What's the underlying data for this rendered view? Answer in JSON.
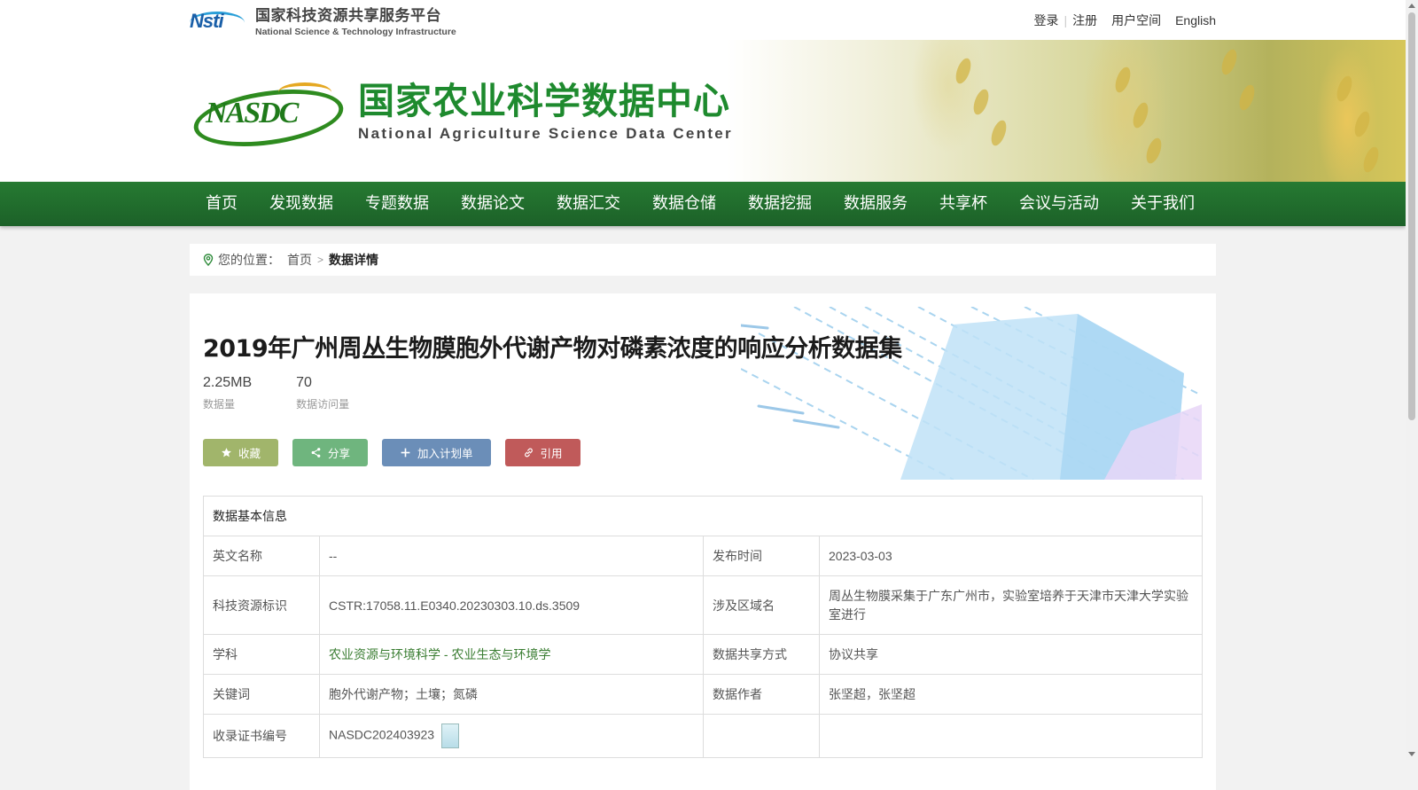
{
  "platform": {
    "name_cn": "国家科技资源共享服务平台",
    "name_en": "National Science & Technology Infrastructure",
    "logo_text": "Nsti"
  },
  "top_links": {
    "login": "登录",
    "separator": "|",
    "register": "注册",
    "user_space": "用户空间",
    "english": "English"
  },
  "center": {
    "logo_text": "NASDC",
    "name_cn": "国家农业科学数据中心",
    "name_en": "National Agriculture Science Data Center"
  },
  "nav": {
    "items": [
      {
        "label": "首页"
      },
      {
        "label": "发现数据"
      },
      {
        "label": "专题数据"
      },
      {
        "label": "数据论文"
      },
      {
        "label": "数据汇交"
      },
      {
        "label": "数据仓储"
      },
      {
        "label": "数据挖掘"
      },
      {
        "label": "数据服务"
      },
      {
        "label": "共享杯"
      },
      {
        "label": "会议与活动"
      },
      {
        "label": "关于我们"
      }
    ]
  },
  "breadcrumb": {
    "prefix": "您的位置：",
    "home": "首页",
    "separator": ">",
    "current": "数据详情"
  },
  "dataset": {
    "title": "2019年广州周丛生物膜胞外代谢产物对磷素浓度的响应分析数据集",
    "stats": [
      {
        "value": "2.25MB",
        "label": "数据量"
      },
      {
        "value": "70",
        "label": "数据访问量"
      }
    ],
    "actions": {
      "favorite": "收藏",
      "share": "分享",
      "add_plan": "加入计划单",
      "cite": "引用"
    }
  },
  "info_table": {
    "section_title": "数据基本信息",
    "rows": [
      {
        "k1": "英文名称",
        "v1": "--",
        "k2": "发布时间",
        "v2": "2023-03-03"
      },
      {
        "k1": "科技资源标识",
        "v1": "CSTR:17058.11.E0340.20230303.10.ds.3509",
        "k2": "涉及区域名",
        "v2": "周丛生物膜采集于广东广州市，实验室培养于天津市天津大学实验室进行"
      },
      {
        "k1": "学科",
        "v1a": "农业资源与环境科学",
        "v1sep": " - ",
        "v1b": "农业生态与环境学",
        "k2": "数据共享方式",
        "v2": "协议共享"
      },
      {
        "k1": "关键词",
        "v1": "胞外代谢产物；土壤；氮磷",
        "k2": "数据作者",
        "v2": "张坚超，张坚超"
      },
      {
        "k1": "收录证书编号",
        "v1": "NASDC202403923",
        "k2": "",
        "v2": ""
      }
    ]
  },
  "colors": {
    "nav_green": "#1f6b2c",
    "brand_green": "#1e8a2e",
    "btn_favorite": "#a1b56b",
    "btn_share": "#6fb57e",
    "btn_plan": "#6b8eb8",
    "btn_cite": "#c05a5a",
    "link_green": "#3a7d32"
  },
  "icons": {
    "location": "location-pin-icon",
    "favorite": "star-icon",
    "share": "share-icon",
    "add_plan": "plus-icon",
    "cite": "link-icon",
    "certificate": "certificate-icon"
  }
}
